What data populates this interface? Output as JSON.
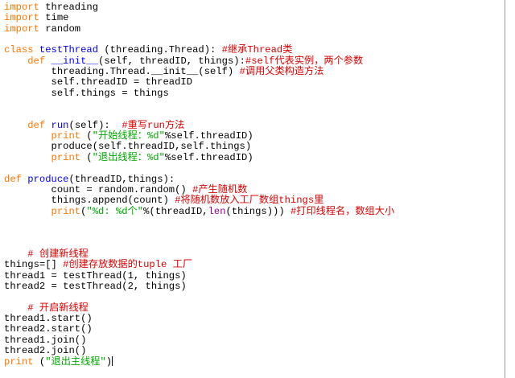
{
  "editor": {
    "colors": {
      "kw": "#ff7700",
      "def": "#0000ff",
      "bi": "#900090",
      "str": "#00aa00",
      "cm": "#dd0000",
      "plain": "#000000"
    },
    "lines": [
      [
        [
          "kw",
          "import"
        ],
        [
          "plain",
          " threading"
        ]
      ],
      [
        [
          "kw",
          "import"
        ],
        [
          "plain",
          " time"
        ]
      ],
      [
        [
          "kw",
          "import"
        ],
        [
          "plain",
          " random"
        ]
      ],
      [],
      [
        [
          "kw",
          "class"
        ],
        [
          "plain",
          " "
        ],
        [
          "def",
          "testThread"
        ],
        [
          "plain",
          " (threading.Thread): "
        ],
        [
          "cm",
          "#继承Thread类"
        ]
      ],
      [
        [
          "plain",
          "    "
        ],
        [
          "kw",
          "def"
        ],
        [
          "plain",
          " "
        ],
        [
          "def",
          "__init__"
        ],
        [
          "plain",
          "(self, threadID, things):"
        ],
        [
          "cm",
          "#self代表实例，两个参数"
        ]
      ],
      [
        [
          "plain",
          "        threading.Thread.__init__(self) "
        ],
        [
          "cm",
          "#调用父类构造方法"
        ]
      ],
      [
        [
          "plain",
          "        self.threadID = threadID"
        ]
      ],
      [
        [
          "plain",
          "        self.things = things"
        ]
      ],
      [],
      [],
      [
        [
          "plain",
          "    "
        ],
        [
          "kw",
          "def"
        ],
        [
          "plain",
          " "
        ],
        [
          "def",
          "run"
        ],
        [
          "plain",
          "(self):  "
        ],
        [
          "cm",
          "#重写run方法"
        ]
      ],
      [
        [
          "plain",
          "        "
        ],
        [
          "kw",
          "print"
        ],
        [
          "plain",
          " ("
        ],
        [
          "str",
          "\"开始线程：%d\""
        ],
        [
          "plain",
          "%self.threadID)"
        ]
      ],
      [
        [
          "plain",
          "        produce(self.threadID,self.things)"
        ]
      ],
      [
        [
          "plain",
          "        "
        ],
        [
          "kw",
          "print"
        ],
        [
          "plain",
          " ("
        ],
        [
          "str",
          "\"退出线程：%d\""
        ],
        [
          "plain",
          "%self.threadID)"
        ]
      ],
      [],
      [
        [
          "kw",
          "def"
        ],
        [
          "plain",
          " "
        ],
        [
          "def",
          "produce"
        ],
        [
          "plain",
          "(threadID,things):"
        ]
      ],
      [
        [
          "plain",
          "        count = random.random() "
        ],
        [
          "cm",
          "#产生随机数"
        ]
      ],
      [
        [
          "plain",
          "        things.append(count) "
        ],
        [
          "cm",
          "#将随机数放入工厂数组things里"
        ]
      ],
      [
        [
          "plain",
          "        "
        ],
        [
          "kw",
          "print"
        ],
        [
          "plain",
          "("
        ],
        [
          "str",
          "\"%d: %d个\""
        ],
        [
          "plain",
          "%(threadID,"
        ],
        [
          "bi",
          "len"
        ],
        [
          "plain",
          "(things))) "
        ],
        [
          "cm",
          "#打印线程名，数组大小"
        ]
      ],
      [],
      [],
      [],
      [
        [
          "plain",
          "    "
        ],
        [
          "cm",
          "# 创建新线程"
        ]
      ],
      [
        [
          "plain",
          "things=[] "
        ],
        [
          "cm",
          "#创建存放数据的tuple 工厂"
        ]
      ],
      [
        [
          "plain",
          "thread1 = testThread(1, things)"
        ]
      ],
      [
        [
          "plain",
          "thread2 = testThread(2, things)"
        ]
      ],
      [],
      [
        [
          "plain",
          "    "
        ],
        [
          "cm",
          "# 开启新线程"
        ]
      ],
      [
        [
          "plain",
          "thread1.start()"
        ]
      ],
      [
        [
          "plain",
          "thread2.start()"
        ]
      ],
      [
        [
          "plain",
          "thread1.join()"
        ]
      ],
      [
        [
          "plain",
          "thread2.join()"
        ]
      ],
      [
        [
          "kw",
          "print"
        ],
        [
          "plain",
          " ("
        ],
        [
          "str",
          "\"退出主线程\""
        ],
        [
          "plain",
          ")"
        ]
      ]
    ]
  }
}
